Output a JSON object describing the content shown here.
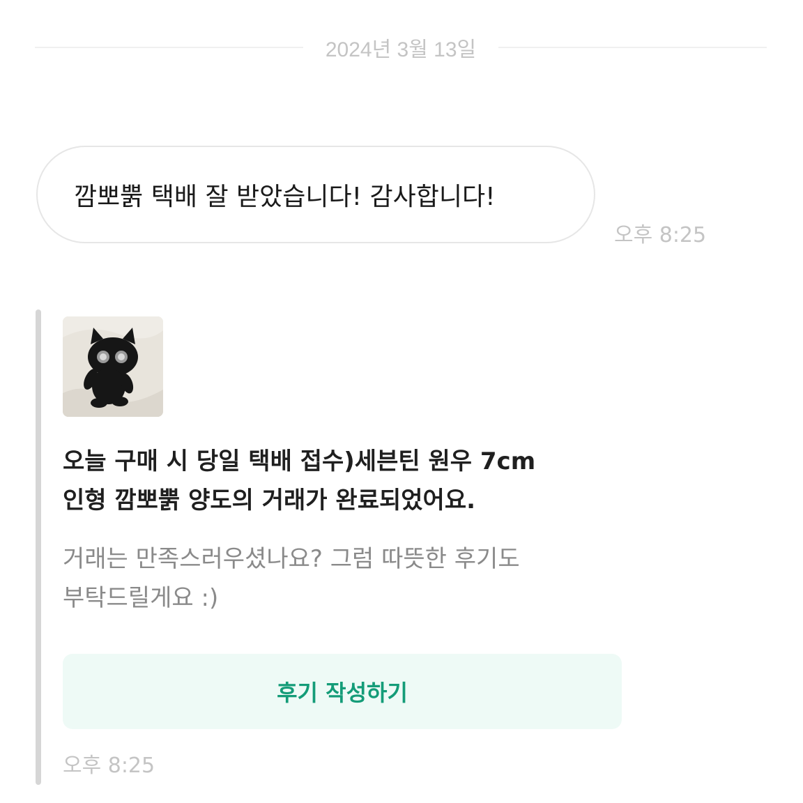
{
  "date_divider": {
    "text": "2024년 3월 13일"
  },
  "message": {
    "text": "깜뽀뿕 택배 잘 받았습니다! 감사합니다!",
    "time": "오후 8:25"
  },
  "trade_card": {
    "thumbnail_icon": "black-cat-plush-photo",
    "title_line_1": "오늘 구매 시 당일 택배 접수)세븐틴 원우 7cm",
    "title_line_2": "인형 깜뽀뿕 양도의 거래가 완료되었어요.",
    "desc_line_1": "거래는 만족스러우셨나요? 그럼 따뜻한 후기도",
    "desc_line_2": "부탁드릴게요 :)",
    "button_label": "후기 작성하기",
    "time": "오후 8:25"
  },
  "colors": {
    "accent_text": "#149c78",
    "accent_bg": "#eefaf6",
    "muted_text": "#c4c4c4"
  }
}
